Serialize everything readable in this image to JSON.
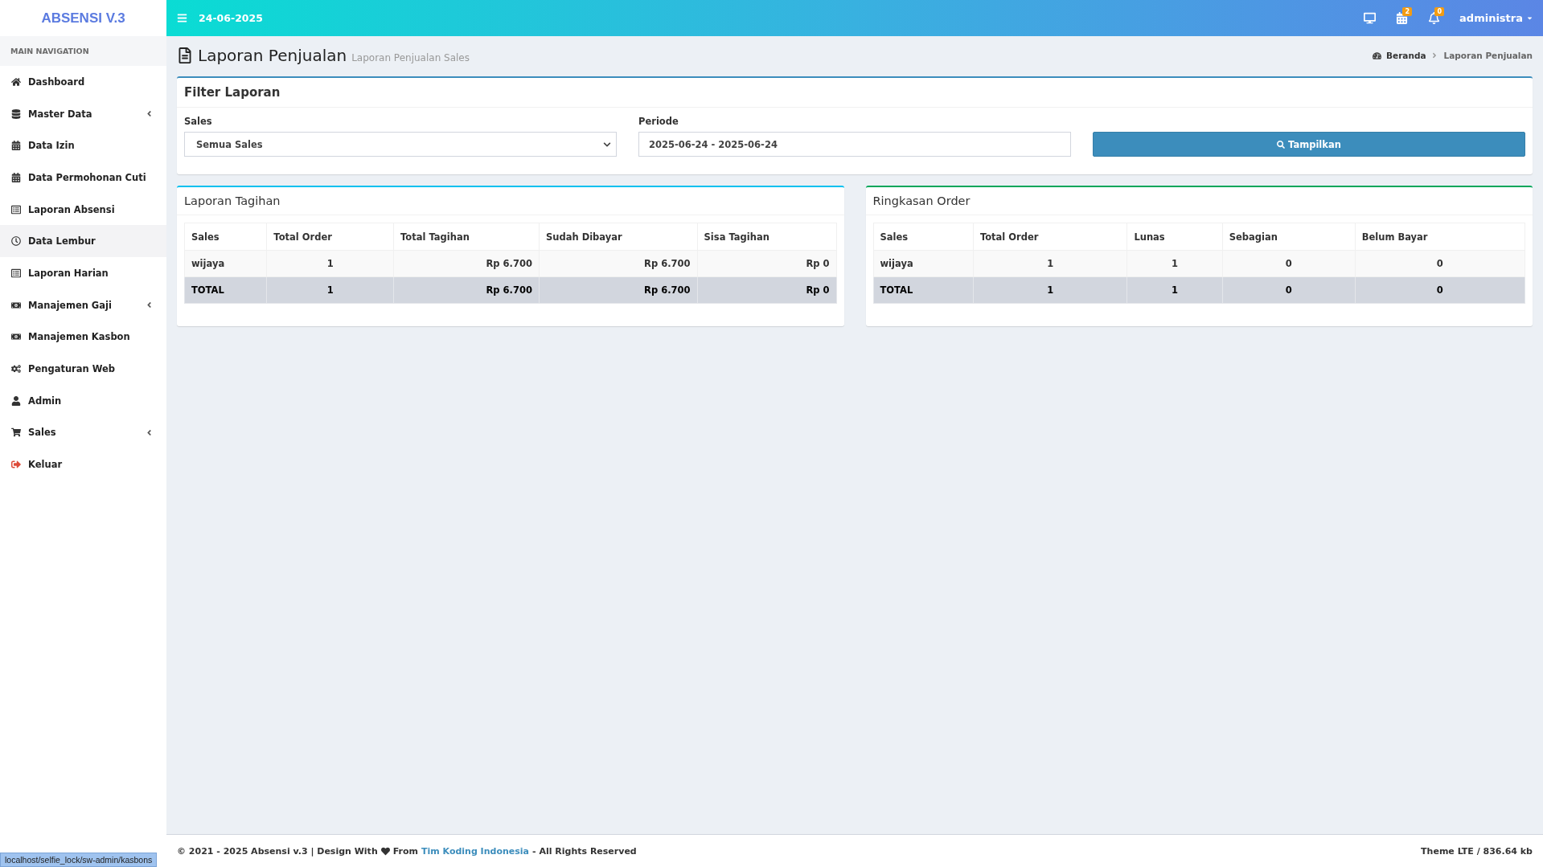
{
  "brand": "ABSENSI V.3",
  "topbar": {
    "date": "24-06-2025",
    "badges": [
      {
        "kind": "monitor"
      },
      {
        "kind": "calendar",
        "count": "2"
      },
      {
        "kind": "bell",
        "count": "0"
      }
    ],
    "user": "administra"
  },
  "sidebar": {
    "header": "MAIN NAVIGATION",
    "items": [
      {
        "label": "Dashboard",
        "kind": "home",
        "expandable": false,
        "selected": false
      },
      {
        "label": "Master Data",
        "kind": "database",
        "expandable": true,
        "selected": false
      },
      {
        "label": "Data Izin",
        "kind": "calendar",
        "expandable": false,
        "selected": false
      },
      {
        "label": "Data Permohonan Cuti",
        "kind": "calendar",
        "expandable": false,
        "selected": false
      },
      {
        "label": "Laporan Absensi",
        "kind": "list",
        "expandable": false,
        "selected": false
      },
      {
        "label": "Data Lembur",
        "kind": "clock",
        "expandable": false,
        "selected": true
      },
      {
        "label": "Laporan Harian",
        "kind": "list",
        "expandable": false,
        "selected": false
      },
      {
        "label": "Manajemen Gaji",
        "kind": "money",
        "expandable": true,
        "selected": false
      },
      {
        "label": "Manajemen Kasbon",
        "kind": "money",
        "expandable": false,
        "selected": false
      },
      {
        "label": "Pengaturan Web",
        "kind": "cogs",
        "expandable": false,
        "selected": false
      },
      {
        "label": "Admin",
        "kind": "user",
        "expandable": false,
        "selected": false
      },
      {
        "label": "Sales",
        "kind": "cart",
        "expandable": true,
        "selected": false
      },
      {
        "label": "Keluar",
        "kind": "logout",
        "expandable": false,
        "selected": false
      }
    ]
  },
  "page": {
    "title": "Laporan Penjualan",
    "subtitle": "Laporan Penjualan Sales",
    "breadcrumb": [
      "Beranda",
      "Laporan Penjualan"
    ]
  },
  "filter": {
    "title": "Filter Laporan",
    "sales_label": "Sales",
    "sales_value": "Semua Sales",
    "period_label": "Periode",
    "period_value": "2025-06-24 - 2025-06-24",
    "button": "Tampilkan"
  },
  "panels": [
    {
      "title": "Laporan Tagihan",
      "color": "#00c0ef",
      "columns": [
        {
          "label": "Sales",
          "kind": "text"
        },
        {
          "label": "Total Order",
          "kind": "count"
        },
        {
          "label": "Total Tagihan",
          "kind": "money"
        },
        {
          "label": "Sudah Dibayar",
          "kind": "money"
        },
        {
          "label": "Sisa Tagihan",
          "kind": "money"
        }
      ],
      "rows": [
        {
          "kind": "data",
          "cells": [
            "wijaya",
            "1",
            "Rp 6.700",
            "Rp 6.700",
            "Rp 0"
          ]
        },
        {
          "kind": "total",
          "cells": [
            "TOTAL",
            "1",
            "Rp 6.700",
            "Rp 6.700",
            "Rp 0"
          ]
        }
      ]
    },
    {
      "title": "Ringkasan Order",
      "color": "#00a65a",
      "columns": [
        {
          "label": "Sales",
          "kind": "text"
        },
        {
          "label": "Total Order",
          "kind": "count"
        },
        {
          "label": "Lunas",
          "kind": "count"
        },
        {
          "label": "Sebagian",
          "kind": "count"
        },
        {
          "label": "Belum Bayar",
          "kind": "count"
        }
      ],
      "rows": [
        {
          "kind": "data",
          "cells": [
            "wijaya",
            "1",
            "1",
            "0",
            "0"
          ]
        },
        {
          "kind": "total",
          "cells": [
            "TOTAL",
            "1",
            "1",
            "0",
            "0"
          ]
        }
      ]
    }
  ],
  "footer": {
    "left_before": "© 2021 - 2025 Absensi v.3 | Design With",
    "left_from": "From",
    "link": "Tim Koding Indonesia",
    "left_after": "- All Rights Reserved",
    "right": "Theme LTE / 836.64 kb"
  },
  "status_url": "localhost/selfie_lock/sw-admin/kasbons"
}
